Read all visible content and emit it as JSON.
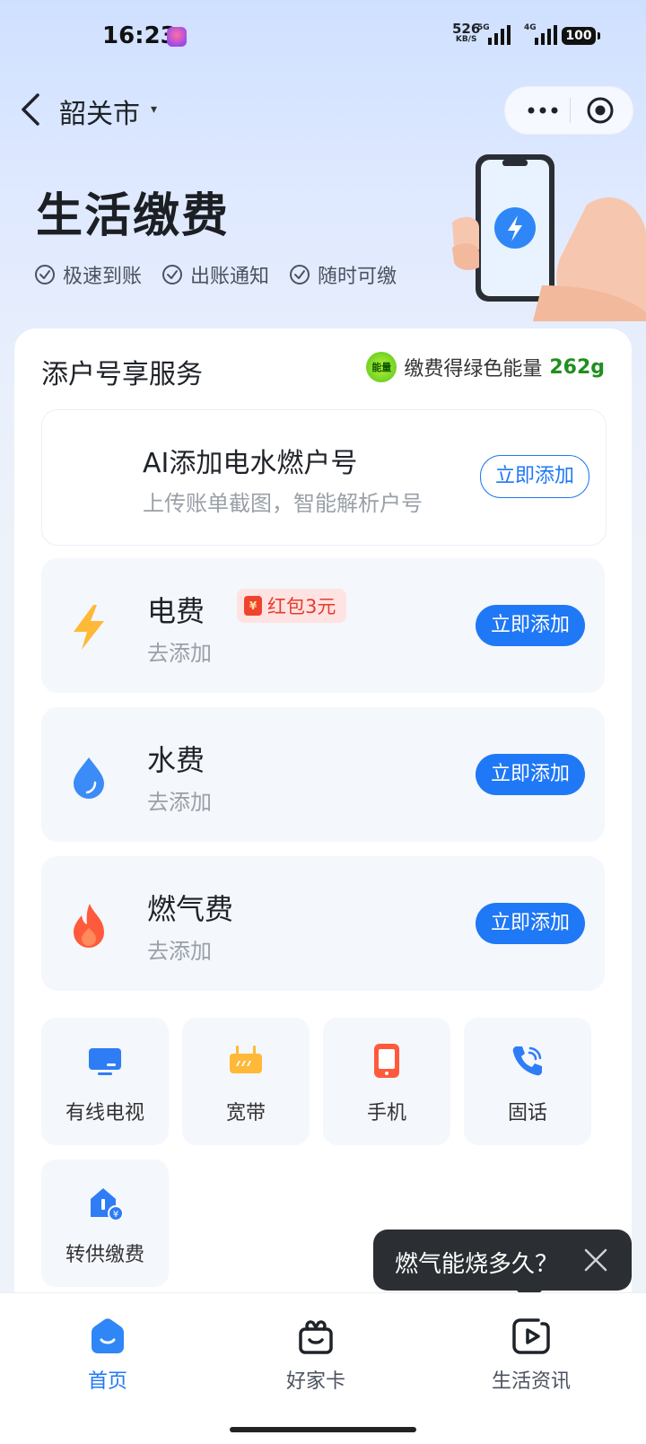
{
  "status_bar": {
    "time": "16:23",
    "net_speed": "526",
    "net_unit": "KB/S",
    "sim1_tag": "5G",
    "sim2_tag": "4G",
    "battery": "100"
  },
  "nav": {
    "city": "韶关市",
    "caret": "▾"
  },
  "hero": {
    "title": "生活缴费",
    "features": [
      "极速到账",
      "出账通知",
      "随时可缴"
    ]
  },
  "service_section": {
    "title": "添户号享服务",
    "energy_badge": "能量",
    "energy_text": "缴费得绿色能量",
    "energy_value": "262g"
  },
  "ai_card": {
    "title": "AI添加电水燃户号",
    "subtitle": "上传账单截图，智能解析户号",
    "button": "立即添加"
  },
  "utilities": [
    {
      "name": "电费",
      "sub": "去添加",
      "button": "立即添加",
      "badge": "红包3元",
      "icon": "lightning-icon"
    },
    {
      "name": "水费",
      "sub": "去添加",
      "button": "立即添加",
      "icon": "water-drop-icon"
    },
    {
      "name": "燃气费",
      "sub": "去添加",
      "button": "立即添加",
      "icon": "flame-icon"
    }
  ],
  "redpack_symbol": "¥",
  "tiles": [
    {
      "label": "有线电视",
      "icon": "tv-icon"
    },
    {
      "label": "宽带",
      "icon": "broadband-icon"
    },
    {
      "label": "手机",
      "icon": "phone-icon"
    },
    {
      "label": "固话",
      "icon": "landline-icon"
    },
    {
      "label": "转供缴费",
      "icon": "transfer-pay-icon"
    }
  ],
  "tooltip": {
    "text": "燃气能烧多久？"
  },
  "tabbar": {
    "items": [
      {
        "label": "首页",
        "icon": "home-icon",
        "active": true
      },
      {
        "label": "好家卡",
        "icon": "gift-icon",
        "active": false
      },
      {
        "label": "生活资讯",
        "icon": "video-icon",
        "active": false
      }
    ]
  },
  "colors": {
    "accent": "#1f78f5",
    "energy_green": "#1f8f1f",
    "redpack_red": "#e83a2b"
  }
}
